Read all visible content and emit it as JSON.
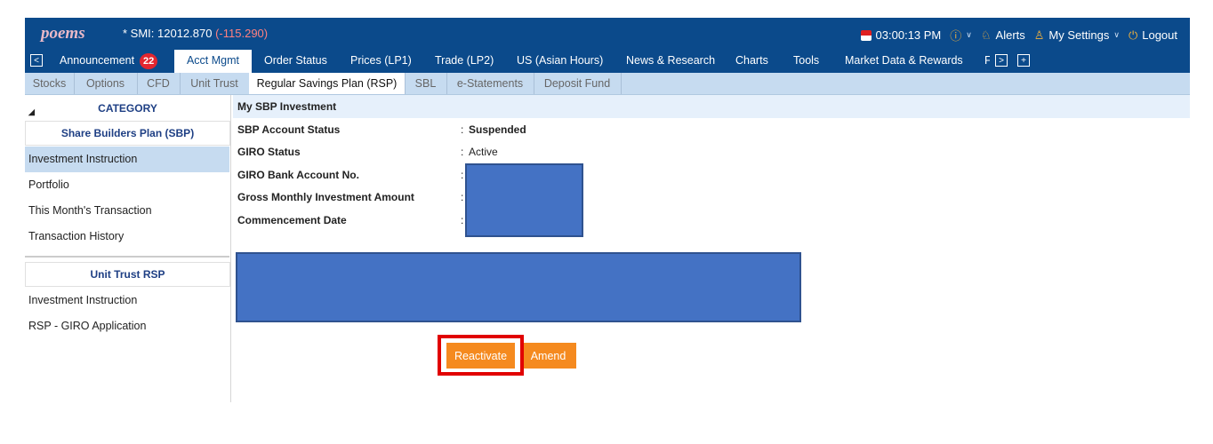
{
  "header": {
    "logo_text": "poems",
    "smi_label": "* SMI: 12012.870",
    "smi_change": "(-115.290)",
    "time": "03:00:13 PM",
    "alerts": "Alerts",
    "settings": "My Settings",
    "logout": "Logout"
  },
  "nav": {
    "tabs": [
      "Announcement",
      "Acct Mgmt",
      "Order Status",
      "Prices (LP1)",
      "Trade (LP2)",
      "US (Asian Hours)",
      "News & Research",
      "Charts",
      "Tools",
      "Market Data & Rewards",
      "F"
    ],
    "announcement_badge": "22",
    "active": "Acct Mgmt"
  },
  "subnav": {
    "tabs": [
      "Stocks",
      "Options",
      "CFD",
      "Unit Trust",
      "Regular Savings Plan (RSP)",
      "SBL",
      "e-Statements",
      "Deposit Fund"
    ],
    "active": "Regular Savings Plan (RSP)"
  },
  "sidebar": {
    "category": "CATEGORY",
    "group1_title": "Share Builders Plan (SBP)",
    "group1_items": [
      "Investment Instruction",
      "Portfolio",
      "This Month's Transaction",
      "Transaction History"
    ],
    "group2_title": "Unit Trust RSP",
    "group2_items": [
      "Investment Instruction",
      "RSP - GIRO Application"
    ]
  },
  "main": {
    "section_title": "My SBP Investment",
    "rows": [
      {
        "label": "SBP Account Status",
        "value": "Suspended"
      },
      {
        "label": "GIRO Status",
        "value": "Active"
      },
      {
        "label": "GIRO Bank Account No.",
        "value": ""
      },
      {
        "label": "Gross Monthly Investment Amount",
        "value": ""
      },
      {
        "label": "Commencement Date",
        "value": ""
      }
    ],
    "reactivate_label": "Reactivate",
    "amend_label": "Amend"
  },
  "colors": {
    "header_bg": "#0b4a8b",
    "subbar_bg": "#c6dbf0",
    "button_orange": "#f58a1f",
    "redaction_blue": "#4472c4",
    "highlight_red": "#e10000"
  }
}
